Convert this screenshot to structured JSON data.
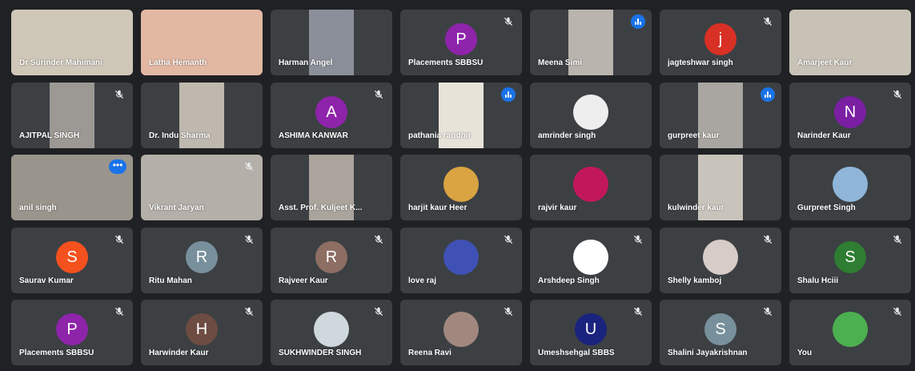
{
  "meeting": {
    "participants": [
      {
        "name": "Dr Surinder Mahimani",
        "type": "video",
        "bg": "#cfc7b8",
        "view": "full",
        "mic": "on"
      },
      {
        "name": "Latha Hemanth",
        "type": "video",
        "bg": "#e3b8a3",
        "view": "full",
        "mic": "on"
      },
      {
        "name": "Harman Angel",
        "type": "video",
        "bg": "#8a8f99",
        "view": "portrait",
        "mic": "on"
      },
      {
        "name": "Placements SBBSU",
        "type": "avatar",
        "initial": "P",
        "color": "#8e24aa",
        "mic": "off"
      },
      {
        "name": "Meena Simi",
        "type": "video",
        "bg": "#b9b4ad",
        "view": "portrait",
        "mic": "speaking"
      },
      {
        "name": "jagteshwar singh",
        "type": "avatar",
        "initial": "j",
        "color": "#d93025",
        "mic": "off"
      },
      {
        "name": "Amarjeet Kaur",
        "type": "video",
        "bg": "#c8c2b6",
        "view": "full",
        "mic": "on"
      },
      {
        "name": "AJITPAL SINGH",
        "type": "video",
        "bg": "#9c9893",
        "view": "portrait",
        "mic": "off"
      },
      {
        "name": "Dr. Indu Sharma",
        "type": "video",
        "bg": "#bfb8ae",
        "view": "portrait",
        "mic": "on"
      },
      {
        "name": "ASHIMA KANWAR",
        "type": "avatar",
        "initial": "A",
        "color": "#8e24aa",
        "mic": "off"
      },
      {
        "name": "pathania randhir",
        "type": "video",
        "bg": "#e8e3d9",
        "view": "portrait",
        "mic": "speaking"
      },
      {
        "name": "amrinder singh",
        "type": "photo",
        "color": "#eeeeee",
        "mic": "on"
      },
      {
        "name": "gurpreet kaur",
        "type": "video",
        "bg": "#a9a6a1",
        "view": "portrait",
        "mic": "speaking"
      },
      {
        "name": "Narinder Kaur",
        "type": "avatar",
        "initial": "N",
        "color": "#7b1fa2",
        "mic": "off"
      },
      {
        "name": "anil singh",
        "type": "video",
        "bg": "#9a958c",
        "view": "full",
        "mic": "more"
      },
      {
        "name": "Vikrant Jaryan",
        "type": "video",
        "bg": "#b4afa8",
        "view": "full",
        "mic": "off"
      },
      {
        "name": "Asst. Prof. Kuljeet K...",
        "type": "video",
        "bg": "#aaa49c",
        "view": "portrait",
        "mic": "on"
      },
      {
        "name": "harjit kaur Heer",
        "type": "photo",
        "color": "#d9a441",
        "mic": "on"
      },
      {
        "name": "rajvir kaur",
        "type": "photo",
        "color": "#c2185b",
        "mic": "on"
      },
      {
        "name": "kulwinder kaur",
        "type": "video",
        "bg": "#c9c4bb",
        "view": "portrait",
        "mic": "on"
      },
      {
        "name": "Gurpreet Singh",
        "type": "photo",
        "color": "#8fb6d9",
        "mic": "on"
      },
      {
        "name": "Saurav Kumar",
        "type": "avatar",
        "initial": "S",
        "color": "#f4511e",
        "mic": "off"
      },
      {
        "name": "Ritu Mahan",
        "type": "avatar",
        "initial": "R",
        "color": "#78909c",
        "mic": "off"
      },
      {
        "name": "Rajveer Kaur",
        "type": "avatar",
        "initial": "R",
        "color": "#8d6e63",
        "mic": "off"
      },
      {
        "name": "love raj",
        "type": "photo",
        "color": "#3f51b5",
        "mic": "off"
      },
      {
        "name": "Arshdeep Singh",
        "type": "photo",
        "color": "#ffffff",
        "mic": "off"
      },
      {
        "name": "Shelly kamboj",
        "type": "photo",
        "color": "#d7ccc8",
        "mic": "off"
      },
      {
        "name": "Shalu Hciii",
        "type": "avatar",
        "initial": "S",
        "color": "#2e7d32",
        "mic": "off"
      },
      {
        "name": "Placements SBBSU",
        "type": "avatar",
        "initial": "P",
        "color": "#8e24aa",
        "mic": "off"
      },
      {
        "name": "Harwinder Kaur",
        "type": "avatar",
        "initial": "H",
        "color": "#6d4c41",
        "mic": "off"
      },
      {
        "name": "SUKHWINDER SINGH",
        "type": "photo",
        "color": "#cfd8dc",
        "mic": "off"
      },
      {
        "name": "Reena Ravi",
        "type": "photo",
        "color": "#a1887f",
        "mic": "off"
      },
      {
        "name": "Umeshsehgal SBBS",
        "type": "avatar",
        "initial": "U",
        "color": "#1a237e",
        "mic": "off"
      },
      {
        "name": "Shalini Jayakrishnan",
        "type": "avatar",
        "initial": "S",
        "color": "#78909c",
        "mic": "off"
      },
      {
        "name": "You",
        "type": "photo",
        "color": "#4caf50",
        "mic": "off"
      }
    ]
  }
}
